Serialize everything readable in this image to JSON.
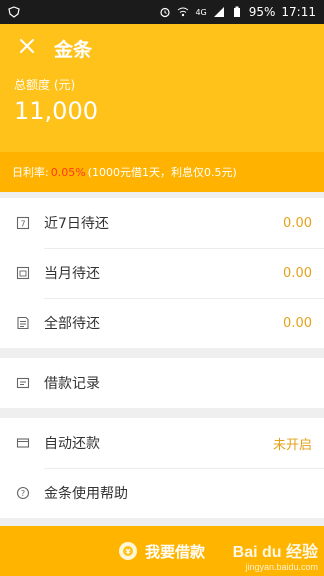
{
  "status_bar": {
    "battery": "95%",
    "time": "17:11",
    "signal_label": "4G"
  },
  "header": {
    "title": "金条",
    "close_icon": "close-icon"
  },
  "hero": {
    "label": "总额度 (元)",
    "amount": "11,000"
  },
  "rate_bar": {
    "prefix": "日利率:",
    "rate": "0.05%",
    "suffix": "(1000元借1天，利息仅0.5元)"
  },
  "repayments": [
    {
      "icon": "calendar-7-icon",
      "label": "近7日待还",
      "value": "0.00"
    },
    {
      "icon": "calendar-month-icon",
      "label": "当月待还",
      "value": "0.00"
    },
    {
      "icon": "document-list-icon",
      "label": "全部待还",
      "value": "0.00"
    }
  ],
  "records": {
    "icon": "record-icon",
    "label": "借款记录"
  },
  "settings": [
    {
      "icon": "card-icon",
      "label": "自动还款",
      "value": "未开启"
    },
    {
      "icon": "help-icon",
      "label": "金条使用帮助",
      "value": ""
    }
  ],
  "cta": {
    "label": "我要借款"
  },
  "watermark": {
    "brand": "Bai du 经验",
    "site": "jingyan.baidu.com"
  },
  "colors": {
    "brand_yellow": "#ffc21a",
    "accent_orange": "#e4a11b",
    "rate_red": "#ff3a1c"
  }
}
